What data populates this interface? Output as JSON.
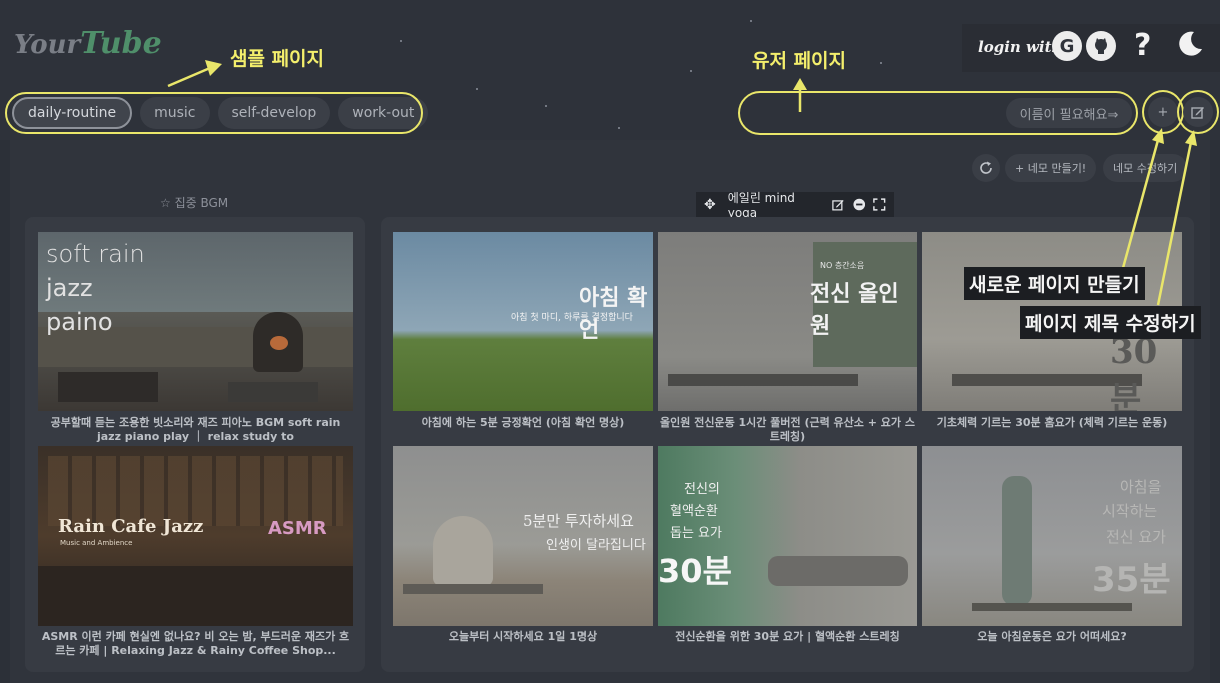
{
  "app": {
    "logo_part1": "Your",
    "logo_part2": "Tube",
    "login_label": "login with",
    "google_icon": "G",
    "github_icon": "github-icon",
    "help_icon": "?",
    "theme_icon": "moon-icon"
  },
  "tabs": [
    "daily-routine",
    "music",
    "self-develop",
    "work-out"
  ],
  "active_tab": "daily-routine",
  "name_input": {
    "placeholder": "이름이 필요해요⇒"
  },
  "add_page_icon": "+",
  "toolbar": {
    "refresh_icon": "refresh-icon",
    "make_label": "+ 네모 만들기!",
    "edit_label": "네모 수정하기"
  },
  "left_panel": {
    "title_icon": "☆",
    "title": "집중 BGM",
    "videos": [
      {
        "thumb_text": [
          "soft rain",
          "jazz",
          "paino"
        ],
        "caption": "공부할때 듣는 조용한 빗소리와 재즈 피아노 BGM soft rain jazz piano play ｜ relax study to"
      },
      {
        "thumb_text": [
          "Rain Cafe Jazz",
          "Music and Ambience",
          "ASMR"
        ],
        "caption": "ASMR 이런 카페 현실엔 없나요? 비 오는 밤, 부드러운 재즈가 흐르는 카페 | Relaxing Jazz & Rainy Coffee Shop..."
      }
    ]
  },
  "right_panel": {
    "title": "에일린 mind yoga",
    "videos": [
      {
        "thumb_text": [
          "아침 확언",
          "아침 첫 마디, 하루를 결정합니다"
        ],
        "caption": "아침에 하는 5분 긍정확언 (아침 확언 명상)"
      },
      {
        "thumb_text": [
          "전신 올인원",
          "NO 층간소음"
        ],
        "caption": "올인원 전신운동 1시간 풀버전 (근력 유산소 + 요가 스트레칭)"
      },
      {
        "thumb_text": [
          "30분"
        ],
        "caption": "기초체력 기르는 30분 홈요가 (체력 기르는 운동)"
      },
      {
        "thumb_text": [
          "5분만 투자하세요",
          "인생이 달라집니다"
        ],
        "caption": "오늘부터 시작하세요 1일 1명상"
      },
      {
        "thumb_text": [
          "전신의",
          "혈액순환",
          "돕는 요가",
          "30분"
        ],
        "caption": "전신순환을 위한 30분 요가 | 혈액순환 스트레칭"
      },
      {
        "thumb_text": [
          "아침을",
          "시작하는",
          "전신 요가",
          "35분"
        ],
        "caption": "오늘 아침운동은 요가 어떠세요?"
      }
    ]
  },
  "annotations": {
    "sample_page": "샘플 페이지",
    "user_page": "유저 페이지",
    "new_page": "새로운 페이지 만들기",
    "edit_title": "페이지 제목 수정하기"
  },
  "colors": {
    "highlight": "#e9e66a",
    "background": "#2c3038",
    "logo_green": "#4f8f6a"
  }
}
